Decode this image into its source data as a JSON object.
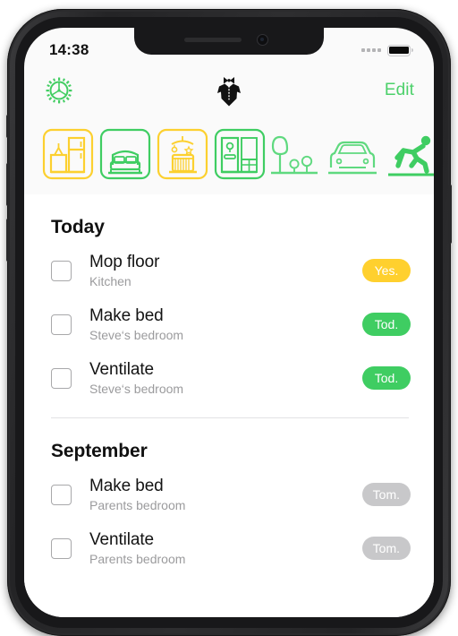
{
  "status_bar": {
    "time": "14:38",
    "signal_icon": "signal-dots-icon",
    "battery_icon": "battery-full-icon"
  },
  "nav_bar": {
    "settings_icon": "gear-icon",
    "logo_icon": "tuxedo-logo-icon",
    "edit_label": "Edit"
  },
  "categories": [
    {
      "name": "kitchen",
      "icon": "kitchen-icon",
      "color": "#fcd02f",
      "framed": true,
      "selected": false
    },
    {
      "name": "bedroom",
      "icon": "bedroom-icon",
      "color": "#3fcd62",
      "framed": true,
      "selected": false
    },
    {
      "name": "nursery",
      "icon": "nursery-icon",
      "color": "#fcd02f",
      "framed": true,
      "selected": false
    },
    {
      "name": "hallway",
      "icon": "hallway-icon",
      "color": "#3fcd62",
      "framed": true,
      "selected": false
    },
    {
      "name": "garden",
      "icon": "garden-icon",
      "color": "#5fd97f",
      "framed": false,
      "selected": false
    },
    {
      "name": "car",
      "icon": "car-icon",
      "color": "#5fd97f",
      "framed": false,
      "selected": false
    },
    {
      "name": "exercise",
      "icon": "running-person-icon",
      "color": "#3fcd62",
      "framed": false,
      "selected": true
    }
  ],
  "sections": [
    {
      "title": "Today",
      "tasks": [
        {
          "title": "Mop floor",
          "location": "Kitchen",
          "badge": "Yes.",
          "badge_color": "#ffd02e",
          "badge_style": "yellow",
          "checked": false
        },
        {
          "title": "Make bed",
          "location": "Steve‘s bedroom",
          "badge": "Tod.",
          "badge_color": "#3fcd62",
          "badge_style": "green",
          "checked": false
        },
        {
          "title": "Ventilate",
          "location": "Steve‘s bedroom",
          "badge": "Tod.",
          "badge_color": "#3fcd62",
          "badge_style": "green",
          "checked": false
        }
      ]
    },
    {
      "title": "September",
      "tasks": [
        {
          "title": "Make bed",
          "location": "Parents bedroom",
          "badge": "Tom.",
          "badge_color": "#c8c8ca",
          "badge_style": "grey",
          "checked": false
        },
        {
          "title": "Ventilate",
          "location": "Parents bedroom",
          "badge": "Tom.",
          "badge_color": "#c8c8ca",
          "badge_style": "grey",
          "checked": false
        }
      ]
    }
  ]
}
